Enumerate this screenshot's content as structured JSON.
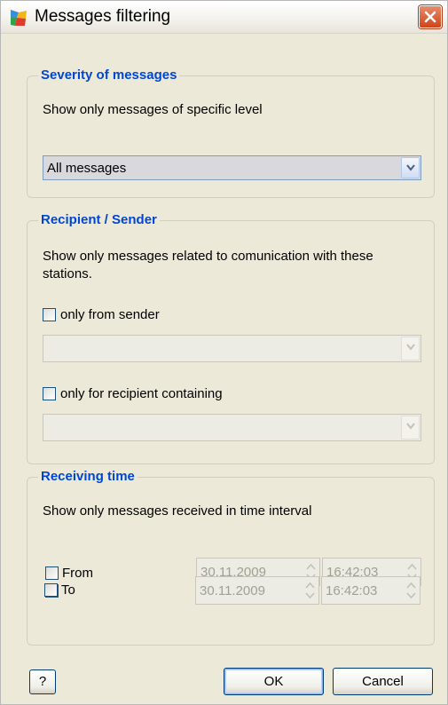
{
  "window": {
    "title": "Messages filtering",
    "icon": "avg-logo-icon",
    "close_icon": "close-icon"
  },
  "severity": {
    "legend": "Severity of messages",
    "description": "Show only messages of specific level",
    "selected": "All messages"
  },
  "recipient": {
    "legend": "Recipient / Sender",
    "description_line1": "Show only messages related to comunication with these",
    "description_line2": "stations.",
    "sender_checkbox_label": "only from sender",
    "sender_checked": false,
    "sender_value": "",
    "recipient_checkbox_label": "only for recipient containing",
    "recipient_checked": false,
    "recipient_value": ""
  },
  "receiving_time": {
    "legend": "Receiving time",
    "description": "Show only messages received in time interval",
    "from_label": "From",
    "from_checked": false,
    "from_date": "30.11.2009",
    "from_time": "16:42:03",
    "to_label": "To",
    "to_checked": false,
    "to_date": "30.11.2009",
    "to_time": "16:42:03"
  },
  "buttons": {
    "help": "?",
    "ok": "OK",
    "cancel": "Cancel"
  },
  "colors": {
    "accent": "#0046d5",
    "background": "#ece9d8",
    "close": "#d0431a"
  }
}
